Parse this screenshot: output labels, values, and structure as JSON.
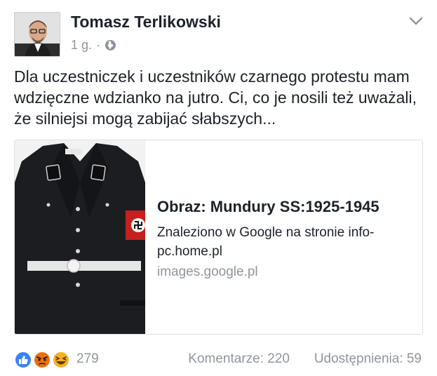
{
  "post": {
    "author": "Tomasz Terlikowski",
    "time": "1 g.",
    "separator": "·",
    "text": "Dla uczestniczek i uczestników czarnego protestu mam wdzięczne wdzianko na jutro. Ci, co je nosili też uważali, że silniejsi mogą zabijać słabszych..."
  },
  "card": {
    "title": "Obraz: Mundury SS:1925-1945",
    "description": "Znaleziono w Google na stronie info-pc.home.pl",
    "domain": "images.google.pl"
  },
  "footer": {
    "reaction_count": "279",
    "comments": "Komentarze: 220",
    "shares": "Udostępnienia: 59"
  },
  "icons": [
    "globe-icon",
    "chevron-down-icon",
    "like-icon",
    "angry-icon",
    "haha-icon"
  ],
  "colors": {
    "like": "#3b82f6",
    "angry": "#e9710f",
    "haha": "#f7b125",
    "muted": "#90949c"
  }
}
